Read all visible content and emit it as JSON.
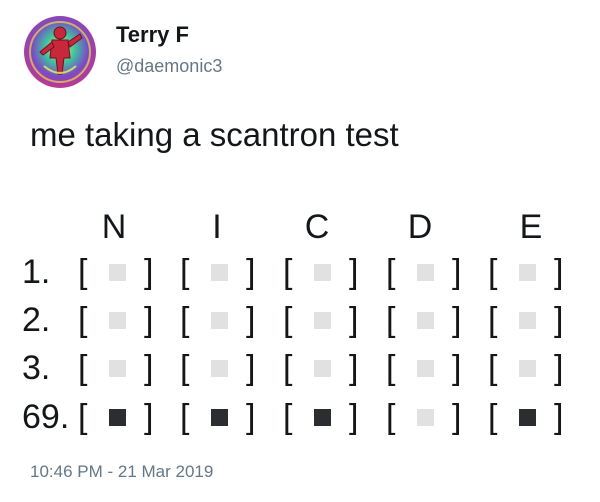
{
  "user": {
    "display_name": "Terry F",
    "handle": "@daemonic3",
    "avatar_icon": "avatar-icon"
  },
  "tweet": {
    "text": "me taking a scantron test",
    "timestamp": "10:46 PM - 21 Mar 2019"
  },
  "scantron": {
    "columns": [
      "N",
      "I",
      "C",
      "D",
      "E"
    ],
    "rows": [
      {
        "label": "1.",
        "marks": [
          false,
          false,
          false,
          false,
          false
        ]
      },
      {
        "label": "2.",
        "marks": [
          false,
          false,
          false,
          false,
          false
        ]
      },
      {
        "label": "3.",
        "marks": [
          false,
          false,
          false,
          false,
          false
        ]
      },
      {
        "label": "69.",
        "marks": [
          true,
          true,
          true,
          false,
          true
        ]
      }
    ],
    "left_bracket": "[",
    "right_bracket": "]"
  },
  "colors": {
    "text": "#14171a",
    "muted": "#657786",
    "box_empty": "#e1e1e1",
    "box_filled": "#2b2d31"
  }
}
